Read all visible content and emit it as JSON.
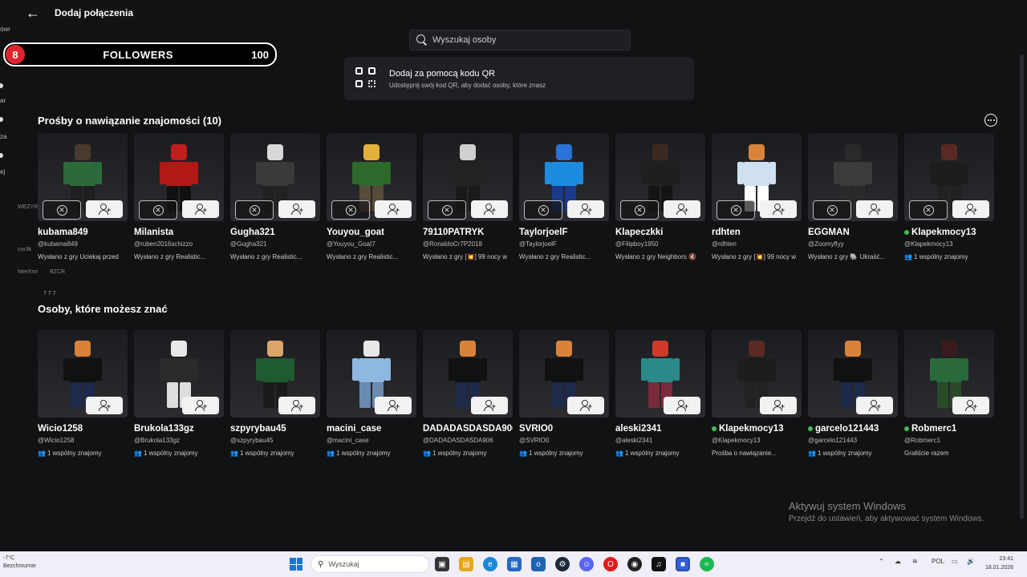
{
  "header": {
    "title": "Dodaj połączenia"
  },
  "left_strip": [
    "ówr",
    "ar",
    "za",
    "ej"
  ],
  "followers_widget": {
    "badge": "8",
    "label": "FOLLOWERS",
    "count": "100"
  },
  "overlay_list": [
    "WEZYR",
    "cor3k",
    "NeeXmi",
    "BZCR",
    "7 7 7"
  ],
  "search": {
    "placeholder": "Wyszukaj osoby"
  },
  "qr_card": {
    "title": "Dodaj za pomocą kodu QR",
    "subtitle": "Udostępnij swój kod QR, aby dodać osoby, które znasz"
  },
  "requests": {
    "title": "Prośby o nawiązanie znajomości (10)",
    "items": [
      {
        "name": "kubama849",
        "handle": "@kubama849",
        "info": "Wysłano z gry Uciekaj przed",
        "online": false,
        "colors": [
          "#4a3a2e",
          "#2d6a3a",
          "#1f1f1f"
        ]
      },
      {
        "name": "Milanista",
        "handle": "@ruben2016schizzo",
        "info": "Wysłano z gry Realistic...",
        "online": false,
        "colors": [
          "#c01d1d",
          "#b31818",
          "#111111"
        ]
      },
      {
        "name": "Gugha321",
        "handle": "@Gugha321",
        "info": "Wysłano z gry Realistic...",
        "online": false,
        "colors": [
          "#d8d8d8",
          "#3a3a3a",
          "#222222"
        ]
      },
      {
        "name": "Youyou_goat",
        "handle": "@Youyou_Goat7",
        "info": "Wysłano z gry Realistic...",
        "online": false,
        "colors": [
          "#e3b23c",
          "#2f6a2c",
          "#5a4a38"
        ]
      },
      {
        "name": "79110PATRYK",
        "handle": "@RonaldoCr7P2018",
        "info": "Wysłano z gry [💥] 99 nocy w",
        "online": false,
        "colors": [
          "#cfcfcf",
          "#222222",
          "#1a1a1a"
        ]
      },
      {
        "name": "TaylorjoelF",
        "handle": "@TaylorjoelF",
        "info": "Wysłano z gry Realistic...",
        "online": false,
        "colors": [
          "#2a72d8",
          "#1d8be0",
          "#1a3a8a"
        ]
      },
      {
        "name": "Klapeczkki",
        "handle": "@Filipboy1950",
        "info": "Wysłano z gry Neighbors 🔇",
        "online": false,
        "colors": [
          "#3a2a22",
          "#1f1f1f",
          "#141414"
        ]
      },
      {
        "name": "rdhten",
        "handle": "@rdhten",
        "info": "Wysłano z gry [💥] 99 nocy w",
        "online": false,
        "colors": [
          "#d9833a",
          "#cfe0f0",
          "#ffffff"
        ]
      },
      {
        "name": "EGGMAN",
        "handle": "@Zoomyflyy",
        "info": "Wysłano z gry 🐘 Ukraść...",
        "online": false,
        "colors": [
          "#2a2a2a",
          "#3b3b3b",
          "#2a2a2a"
        ]
      },
      {
        "name": "Klapekmocy13",
        "handle": "@Klapekmocy13",
        "info": "1 wspólny znajomy",
        "online": true,
        "colors": [
          "#5a2a22",
          "#1d1d1d",
          "#222222"
        ]
      }
    ]
  },
  "suggestions": {
    "title": "Osoby, które możesz znać",
    "items": [
      {
        "name": "Wicio1258",
        "handle": "@Wicio1258",
        "info": "1 wspólny znajomy",
        "online": false,
        "colors": [
          "#d9833a",
          "#111111",
          "#1e2a4a"
        ]
      },
      {
        "name": "Brukola133gz",
        "handle": "@Brukola133gz",
        "info": "1 wspólny znajomy",
        "online": false,
        "colors": [
          "#e8e8e8",
          "#2a2a2a",
          "#dddddd"
        ]
      },
      {
        "name": "szpyrybau45",
        "handle": "@szpyrybau45",
        "info": "1 wspólny znajomy",
        "online": false,
        "colors": [
          "#d9a56a",
          "#1f5a30",
          "#1a1a1a"
        ]
      },
      {
        "name": "macini_case",
        "handle": "@macini_case",
        "info": "1 wspólny znajomy",
        "online": false,
        "colors": [
          "#e8e8e8",
          "#8fb8e0",
          "#6a8ab0"
        ]
      },
      {
        "name": "DADADASDASDA906",
        "handle": "@DADADASDASDA906",
        "info": "1 wspólny znajomy",
        "online": false,
        "colors": [
          "#d9833a",
          "#111111",
          "#1e2a4a"
        ]
      },
      {
        "name": "SVRIO0",
        "handle": "@SVRIO0",
        "info": "1 wspólny znajomy",
        "online": false,
        "colors": [
          "#d9833a",
          "#111111",
          "#1e2a4a"
        ]
      },
      {
        "name": "aleski2341",
        "handle": "@aleski2341",
        "info": "1 wspólny znajomy",
        "online": false,
        "colors": [
          "#d03a2a",
          "#2a8a8a",
          "#7a2a3a"
        ]
      },
      {
        "name": "Klapekmocy13",
        "handle": "@Klapekmocy13",
        "info": "Prośba o nawiązanie...",
        "online": true,
        "colors": [
          "#5a2a22",
          "#1d1d1d",
          "#222222"
        ]
      },
      {
        "name": "garcelo121443",
        "handle": "@garcelo121443",
        "info": "1 wspólny znajomy",
        "online": true,
        "colors": [
          "#d9833a",
          "#111111",
          "#1e2a4a"
        ]
      },
      {
        "name": "Robmerc1",
        "handle": "@Robmerc1",
        "info": "Graliście razem",
        "online": true,
        "colors": [
          "#3a1a1a",
          "#2a6a3a",
          "#2a4a2a"
        ]
      }
    ]
  },
  "watermark": {
    "line1": "Aktywuj system Windows",
    "line2": "Przejdź do ustawień, aby aktywować system Windows."
  },
  "taskbar": {
    "weather_temp": "-7°C",
    "weather_desc": "Bezchmurnie",
    "search_placeholder": "Wyszukaj",
    "lang": "POL",
    "time": "23:41",
    "date": "18.01.2026"
  }
}
